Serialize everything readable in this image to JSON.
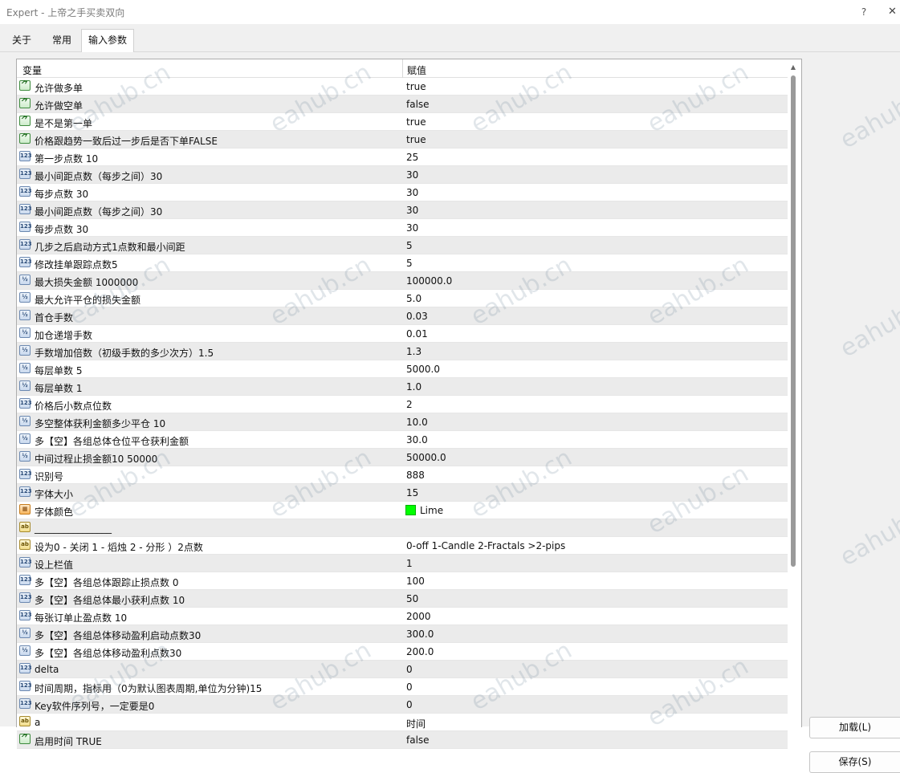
{
  "window": {
    "title": "Expert - 上帝之手买卖双向",
    "help_label": "?",
    "close_label": "✕"
  },
  "tabs": [
    {
      "label": "关于",
      "active": false
    },
    {
      "label": "常用",
      "active": false
    },
    {
      "label": "输入参数",
      "active": true
    }
  ],
  "grid": {
    "columns": {
      "variable": "变量",
      "value": "赋值"
    },
    "rows": [
      {
        "type": "bool",
        "icon": "bool-icon",
        "name": "允许做多单",
        "value": "true"
      },
      {
        "type": "bool",
        "icon": "bool-icon",
        "name": "允许做空单",
        "value": "false"
      },
      {
        "type": "bool",
        "icon": "bool-icon",
        "name": "是不是第一单",
        "value": "true"
      },
      {
        "type": "bool",
        "icon": "bool-icon",
        "name": "价格跟趋势一致后过一步后是否下单FALSE",
        "value": "true"
      },
      {
        "type": "int",
        "icon": "int-icon",
        "name": "第一步点数  10",
        "value": "25"
      },
      {
        "type": "int",
        "icon": "int-icon",
        "name": "最小间距点数（每步之间）30",
        "value": "30"
      },
      {
        "type": "int",
        "icon": "int-icon",
        "name": "每步点数  30",
        "value": "30"
      },
      {
        "type": "int",
        "icon": "int-icon",
        "name": "最小间距点数（每步之间）30",
        "value": "30"
      },
      {
        "type": "int",
        "icon": "int-icon",
        "name": "每步点数  30",
        "value": "30"
      },
      {
        "type": "int",
        "icon": "int-icon",
        "name": "几步之后启动方式1点数和最小间距",
        "value": "5"
      },
      {
        "type": "int",
        "icon": "int-icon",
        "name": "修改挂单跟踪点数5",
        "value": "5"
      },
      {
        "type": "dbl",
        "icon": "double-icon",
        "name": "最大损失金额    1000000",
        "value": "100000.0"
      },
      {
        "type": "dbl",
        "icon": "double-icon",
        "name": "最大允许平仓的损失金额",
        "value": "5.0"
      },
      {
        "type": "dbl",
        "icon": "double-icon",
        "name": "首仓手数",
        "value": "0.03"
      },
      {
        "type": "dbl",
        "icon": "double-icon",
        "name": "加仓递增手数",
        "value": "0.01"
      },
      {
        "type": "dbl",
        "icon": "double-icon",
        "name": "手数增加倍数（初级手数的多少次方）1.5",
        "value": "1.3"
      },
      {
        "type": "dbl",
        "icon": "double-icon",
        "name": "每层单数  5",
        "value": "5000.0"
      },
      {
        "type": "dbl",
        "icon": "double-icon",
        "name": "每层单数  1",
        "value": "1.0"
      },
      {
        "type": "int",
        "icon": "int-icon",
        "name": "价格后小数点位数",
        "value": "2"
      },
      {
        "type": "dbl",
        "icon": "double-icon",
        "name": "多空整体获利金额多少平仓 10",
        "value": "10.0"
      },
      {
        "type": "dbl",
        "icon": "double-icon",
        "name": "多【空】各组总体仓位平仓获利金额",
        "value": "30.0"
      },
      {
        "type": "dbl",
        "icon": "double-icon",
        "name": "中间过程止损金额10 50000",
        "value": "50000.0"
      },
      {
        "type": "int",
        "icon": "int-icon",
        "name": "识别号",
        "value": "888"
      },
      {
        "type": "int",
        "icon": "int-icon",
        "name": "字体大小",
        "value": "15"
      },
      {
        "type": "col",
        "icon": "color-icon",
        "name": "字体颜色",
        "value": "Lime",
        "swatch": "#00ff00"
      },
      {
        "type": "str",
        "icon": "string-icon",
        "name": "________________",
        "value": ""
      },
      {
        "type": "str",
        "icon": "string-icon",
        "name": "设为0 - 关闭 1 - 熖烛 2 - 分形 ）2点数",
        "value": "0-off  1-Candle  2-Fractals   >2-pips"
      },
      {
        "type": "int",
        "icon": "int-icon",
        "name": "设上栏值",
        "value": "1"
      },
      {
        "type": "int",
        "icon": "int-icon",
        "name": "多【空】各组总体跟踪止损点数 0",
        "value": "100"
      },
      {
        "type": "int",
        "icon": "int-icon",
        "name": "多【空】各组总体最小获利点数 10",
        "value": "50"
      },
      {
        "type": "int",
        "icon": "int-icon",
        "name": "每张订单止盈点数 10",
        "value": "2000"
      },
      {
        "type": "dbl",
        "icon": "double-icon",
        "name": "多【空】各组总体移动盈利启动点数30",
        "value": "300.0"
      },
      {
        "type": "dbl",
        "icon": "double-icon",
        "name": "多【空】各组总体移动盈利点数30",
        "value": "200.0"
      },
      {
        "type": "int",
        "icon": "int-icon",
        "name": "delta",
        "value": "0"
      },
      {
        "type": "int",
        "icon": "int-icon",
        "name": "时间周期，指标用（0为默认图表周期,单位为分钟)15",
        "value": "0"
      },
      {
        "type": "int",
        "icon": "int-icon",
        "name": "Key软件序列号，一定要是0",
        "value": "0"
      },
      {
        "type": "str",
        "icon": "string-icon",
        "name": "a",
        "value": "时间"
      },
      {
        "type": "bool",
        "icon": "bool-icon",
        "name": "启用时间   TRUE",
        "value": "false"
      }
    ]
  },
  "icon_glyphs": {
    "bool": "⺈",
    "int": "123",
    "dbl": "½",
    "str": "ab",
    "col": "▦"
  },
  "buttons": {
    "load": "加载(L)",
    "save": "保存(S)"
  },
  "watermark": "eahub.cn"
}
